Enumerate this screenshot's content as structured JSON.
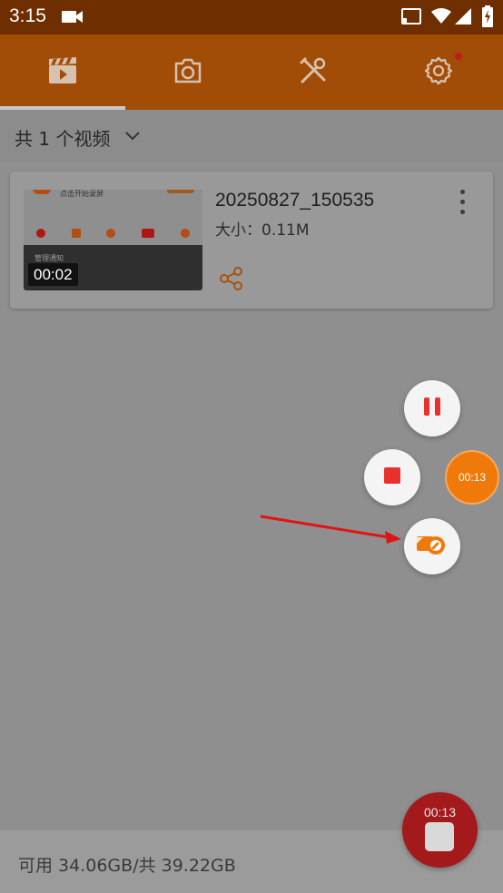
{
  "status_bar": {
    "time": "3:15",
    "icons": [
      "video-camera-icon",
      "cast-icon",
      "wifi-icon",
      "signal-icon",
      "battery-charging-icon"
    ]
  },
  "tabs": [
    {
      "icon": "video-clapper-icon",
      "active": true
    },
    {
      "icon": "camera-icon",
      "active": false
    },
    {
      "icon": "tools-icon",
      "active": false
    },
    {
      "icon": "settings-gear-icon",
      "active": false,
      "badge": true
    }
  ],
  "list_header": {
    "count_label": "共 1 个视频"
  },
  "videos": [
    {
      "filename": "20250827_150535",
      "size": "大小：0.11M",
      "duration": "00:02",
      "thumbnail": {
        "top_text": "点击开始录屏",
        "note_text": "管理通知"
      }
    }
  ],
  "floating_controls": {
    "timer": "00:13",
    "buttons": [
      "pause-icon",
      "stop-icon",
      "camera-tools-icon"
    ]
  },
  "storage": {
    "text": "可用 34.06GB/共 39.22GB"
  },
  "record_fab": {
    "time": "00:13"
  },
  "colors": {
    "accent": "#f07a09",
    "toolbar": "#a24d07",
    "status_bar": "#6e2e00",
    "record_red": "#a41a1c",
    "control_red": "#e8302c",
    "annotation_arrow": "#e01414"
  }
}
